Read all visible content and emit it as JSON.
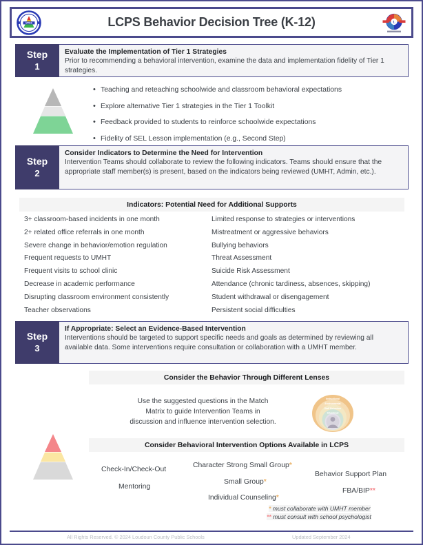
{
  "header": {
    "title": "LCPS Behavior Decision Tree (K-12)",
    "left_logo": "mtss-logo",
    "right_logo": "lcps-seal-logo"
  },
  "steps": [
    {
      "label": "Step",
      "number": "1",
      "heading": "Evaluate the Implementation of Tier 1 Strategies",
      "description": "Prior to recommending a behavioral intervention, examine the data and implementation fidelity of Tier 1 strategies."
    },
    {
      "label": "Step",
      "number": "2",
      "heading": "Consider Indicators to Determine the Need for Intervention",
      "description": "Intervention Teams should collaborate to review the following indicators. Teams should ensure that the appropriate staff member(s) is present, based on the indicators being reviewed (UMHT, Admin, etc.)."
    },
    {
      "label": "Step",
      "number": "3",
      "heading": "If Appropriate: Select an Evidence-Based Intervention",
      "description": "Interventions should be targeted to support specific needs and goals as determined by reviewing all available data. Some interventions require consultation or collaboration with a UMHT member."
    }
  ],
  "tier1_bullets": [
    "Teaching and reteaching schoolwide and classroom behavioral expectations",
    "Explore alternative Tier 1 strategies in the Tier 1 Toolkit",
    "Feedback provided to students to reinforce schoolwide expectations",
    "Fidelity of SEL Lesson implementation (e.g., Second Step)"
  ],
  "indicators": {
    "title": "Indicators: Potential Need for Additional Supports",
    "left": [
      "3+ classroom-based incidents in one month",
      "2+ related office referrals in one month",
      "Severe change in behavior/emotion regulation",
      "Frequent requests to UMHT",
      "Frequent visits to school clinic",
      "Decrease in academic performance",
      "Disrupting classroom environment consistently",
      "Teacher observations"
    ],
    "right": [
      "Limited response to strategies or interventions",
      "Mistreatment or aggressive behaviors",
      "Bullying behaviors",
      "Threat Assessment",
      "Suicide Risk Assessment",
      "Attendance (chronic tardiness, absences, skipping)",
      "Student withdrawal or disengagement",
      "Persistent social difficulties"
    ]
  },
  "lenses": {
    "title": "Consider the Behavior Through Different Lenses",
    "text_line1": "Use the suggested questions in the Match",
    "text_line2": "Matrix to guide Intervention Teams in",
    "text_line3": "discussion and influence intervention selection.",
    "circle_labels": [
      "Instructional",
      "Environmental",
      "Staff Behaviors",
      "Situational"
    ]
  },
  "interventions": {
    "title": "Consider Behavioral Intervention Options Available in LCPS",
    "options": [
      {
        "label": "Check-In/Check-Out",
        "marker": ""
      },
      {
        "label": "Mentoring",
        "marker": ""
      },
      {
        "label": "Character Strong Small Group",
        "marker": "*"
      },
      {
        "label": "Small Group",
        "marker": "*"
      },
      {
        "label": "Individual Counseling",
        "marker": "*"
      },
      {
        "label": "Behavior Support Plan",
        "marker": ""
      },
      {
        "label": "FBA/BIP",
        "marker": "**"
      }
    ],
    "footnote1_marker": "*",
    "footnote1": " must collaborate with UMHT member",
    "footnote2_marker": "**",
    "footnote2": " must consult with school psychologist"
  },
  "footer": {
    "left": "All Rights Reserved. © 2024 Loudoun County Public Schools",
    "right": "Updated September 2024"
  },
  "colors": {
    "accent_purple": "#4b4a8c",
    "step_badge": "#3f3c6b",
    "tier1_green": "#7ed496",
    "tier3_red": "#f4868a",
    "tier2_yellow": "#fbe6a2",
    "gray": "#d9d9d9",
    "bar_gray": "#f4f4f4"
  }
}
